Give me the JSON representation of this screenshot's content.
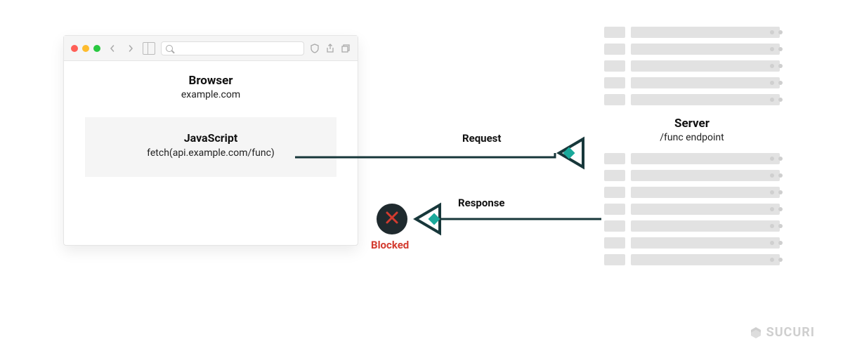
{
  "browser": {
    "title": "Browser",
    "domain": "example.com",
    "js_title": "JavaScript",
    "js_code": "fetch(api.example.com/func)"
  },
  "server": {
    "title": "Server",
    "endpoint": "/func endpoint"
  },
  "arrows": {
    "request_label": "Request",
    "response_label": "Response"
  },
  "blocked": {
    "label": "Blocked"
  },
  "logo": {
    "text": "SUCURI"
  },
  "colors": {
    "line": "#17373a",
    "teal": "#1aa99b",
    "blocked_bg": "#1f2a2e",
    "blocked_fg": "#d33b2f"
  }
}
